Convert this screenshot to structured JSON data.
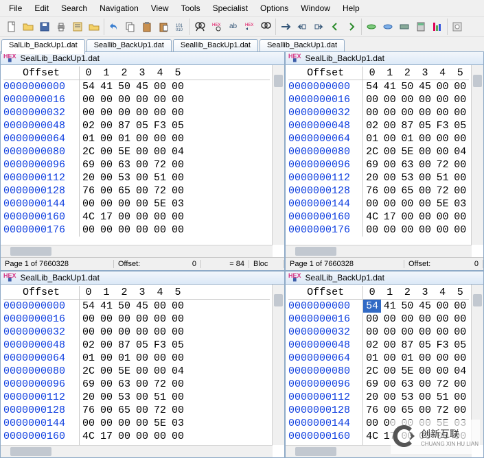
{
  "menu": {
    "items": [
      "File",
      "Edit",
      "Search",
      "Navigation",
      "View",
      "Tools",
      "Specialist",
      "Options",
      "Window",
      "Help"
    ]
  },
  "tabs": [
    "SalLib_BackUp1.dat",
    "Seallib_BackUp1.dat",
    "Seallib_BackUp1.dat",
    "Seallib_BackUp1.dat"
  ],
  "hex": {
    "file": "SealLib_BackUp1.dat",
    "offset_header": "Offset",
    "byte_headers": [
      "0",
      "1",
      "2",
      "3",
      "4",
      "5"
    ],
    "rows": [
      {
        "offset": "0000000000",
        "b": [
          "54",
          "41",
          "50",
          "45",
          "00",
          "00"
        ]
      },
      {
        "offset": "0000000016",
        "b": [
          "00",
          "00",
          "00",
          "00",
          "00",
          "00"
        ]
      },
      {
        "offset": "0000000032",
        "b": [
          "00",
          "00",
          "00",
          "00",
          "00",
          "00"
        ]
      },
      {
        "offset": "0000000048",
        "b": [
          "02",
          "00",
          "87",
          "05",
          "F3",
          "05"
        ]
      },
      {
        "offset": "0000000064",
        "b": [
          "01",
          "00",
          "01",
          "00",
          "00",
          "00"
        ]
      },
      {
        "offset": "0000000080",
        "b": [
          "2C",
          "00",
          "5E",
          "00",
          "00",
          "04"
        ]
      },
      {
        "offset": "0000000096",
        "b": [
          "69",
          "00",
          "63",
          "00",
          "72",
          "00"
        ]
      },
      {
        "offset": "0000000112",
        "b": [
          "20",
          "00",
          "53",
          "00",
          "51",
          "00"
        ]
      },
      {
        "offset": "0000000128",
        "b": [
          "76",
          "00",
          "65",
          "00",
          "72",
          "00"
        ]
      },
      {
        "offset": "0000000144",
        "b": [
          "00",
          "00",
          "00",
          "00",
          "5E",
          "03"
        ]
      },
      {
        "offset": "0000000160",
        "b": [
          "4C",
          "17",
          "00",
          "00",
          "00",
          "00"
        ]
      },
      {
        "offset": "0000000176",
        "b": [
          "00",
          "00",
          "00",
          "00",
          "00",
          "00"
        ]
      }
    ]
  },
  "status": {
    "page": "Page 1 of 7660328",
    "offset_label": "Offset:",
    "offset_value": "0",
    "eq_label": "= 84",
    "block_label": "Bloc"
  },
  "brand": {
    "cn": "创新互联",
    "py": "CHUANG XIN HU LIAN"
  }
}
